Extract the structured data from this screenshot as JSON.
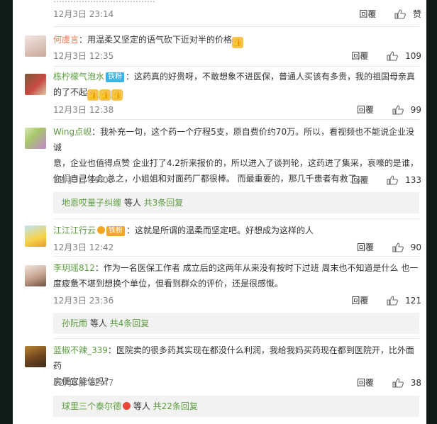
{
  "top": {
    "snippet": "………………………………",
    "date": "12月3日 23:14",
    "reply": "回覆",
    "likes": "赞"
  },
  "comments": [
    {
      "name": "何虞言",
      "text": "：用温柔又坚定的语气砍下近对半的价格",
      "emoji_count": 1,
      "date": "12月3日 12:35",
      "reply": "回覆",
      "likes": "109"
    },
    {
      "name": "栋柠檬气泡水",
      "badge": "铁粉",
      "text_line1": "：这药真的好贵呀，不敢想象不进医保，普通人买该有多贵，我的祖国母亲真",
      "text_line2": "的了不起",
      "emoji_count": 3,
      "date": "12月3日 12:38",
      "reply": "回覆",
      "likes": "99"
    },
    {
      "name": "Wing点岘",
      "text_line1": "：我补充一句，这个药一个疗程5支，原自费价约70万。所以，看视频也不能说企业没诚",
      "text_line2": "意，企业也值得点赞 企业打了4.2折来报价的，所以进入了谈判轮，这药进了集采，哀嚎的是谁，",
      "text_line3": "你们自己体会 总之，小姐姐和对面药厂都很棒。 而最重要的，那几千患者有救了。",
      "date": "12月3日 19:03",
      "reply": "回覆",
      "likes": "133",
      "more": {
        "who": "地恩哎量子纠缠",
        "mid": " 等人 ",
        "total": "共3条回复"
      }
    },
    {
      "name": "江江江行云",
      "badge": "铁粉",
      "text": "：这就是所谓的温柔而坚定吧。好想成为这样的人",
      "date": "12月3日 12:42",
      "reply": "回覆",
      "likes": "90"
    },
    {
      "name": "李玥瑶812",
      "text_line1": "：作为一名医保工作者 成立后的这两年从来没有按时下过班 周末也不知道是什么 也一",
      "text_line2": "度疲惫不堪到想换个单位，但看到群众的评价，还是很感慨。",
      "date": "12月3日 23:36",
      "reply": "回覆",
      "likes": "121",
      "more": {
        "who": "孙阮雨",
        "mid": " 等人 ",
        "total": "共4条回复"
      }
    },
    {
      "name": "蓝椒不辣_339",
      "text_line1": "：医院卖的很多药其实现在都没什么利润，我给我妈买药现在都到医院开，比外面药",
      "text_line2": "房便宜能信吗？",
      "date": "12月3日 12:47",
      "reply": "回覆",
      "likes": "38",
      "more": {
        "who": "球里三个泰尔德",
        "mid": " 等人 ",
        "total": "共22条回复"
      }
    }
  ],
  "colors": {
    "name": "#eb7350",
    "name_green": "#5c9b3f",
    "badge": "#3cb1e6",
    "date": "#808080"
  }
}
